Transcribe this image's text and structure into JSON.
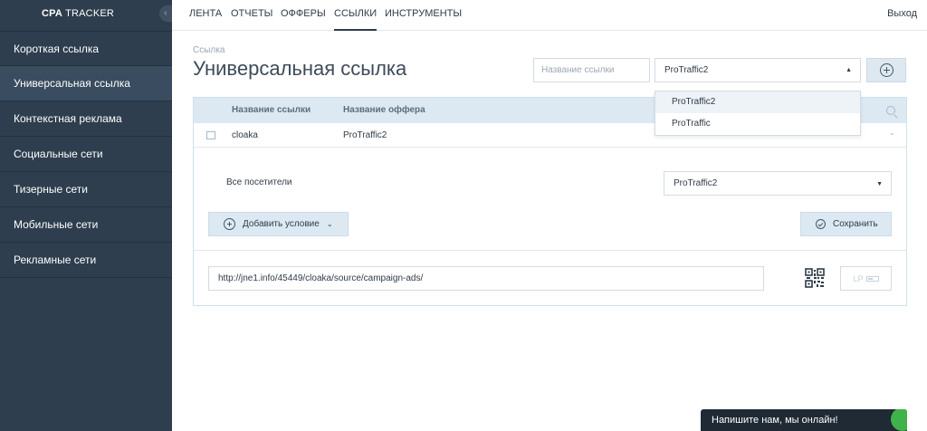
{
  "sidebar": {
    "logo": {
      "brand": "CPA",
      "product": "TRACKER"
    },
    "collapse_icon": "chevron-left-icon",
    "items": [
      {
        "label": "Короткая ссылка"
      },
      {
        "label": "Универсальная ссылка"
      },
      {
        "label": "Контекстная реклама"
      },
      {
        "label": "Социальные сети"
      },
      {
        "label": "Тизерные сети"
      },
      {
        "label": "Мобильные сети"
      },
      {
        "label": "Рекламные сети"
      }
    ],
    "active_index": 1
  },
  "topnav": {
    "items": [
      {
        "label": "ЛЕНТА"
      },
      {
        "label": "ОТЧЕТЫ"
      },
      {
        "label": "ОФФЕРЫ"
      },
      {
        "label": "ССЫЛКИ"
      },
      {
        "label": "ИНСТРУМЕНТЫ"
      }
    ],
    "active": "ССЫЛКИ",
    "logout_label": "Выход"
  },
  "header": {
    "breadcrumb": "Ссылка",
    "title": "Универсальная ссылка",
    "name_placeholder": "Название ссылки",
    "offer_select_value": "ProTraffic2",
    "add_icon": "plus-circle-icon"
  },
  "offer_dropdown": {
    "options": [
      "ProTraffic2",
      "ProTraffic"
    ],
    "selected": "ProTraffic2"
  },
  "table": {
    "columns": [
      "Название ссылки",
      "Название оффера"
    ],
    "rows": [
      {
        "link_name": "cloaka",
        "offer_name": "ProTraffic2"
      }
    ],
    "details": {
      "visitors_label": "Все посетители",
      "offer_value": "ProTraffic2",
      "add_condition_label": "Добавить условие",
      "save_label": "Сохранить",
      "url": "http://jne1.info/45449/cloaka/source/campaign-ads/",
      "lp_label": "LP"
    }
  },
  "chat": {
    "label": "Напишите нам, мы онлайн!",
    "status_color": "#3fb24a"
  },
  "colors": {
    "sidebar_bg": "#2e3e4e",
    "sidebar_active": "#3a4c5f",
    "table_header_bg": "#dce9f3",
    "accent_button_bg": "#dce9f3"
  }
}
